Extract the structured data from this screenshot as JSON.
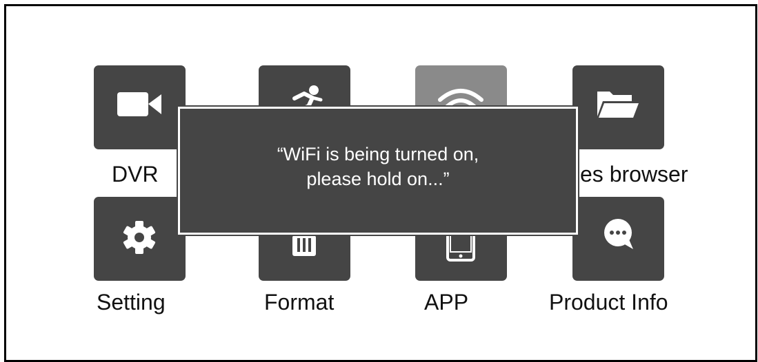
{
  "colors": {
    "tile": "#454545",
    "tile_selected": "#8a8a8a",
    "dialog": "#454545",
    "dialog_text": "#ffffff",
    "label": "#111111"
  },
  "menu": {
    "items": [
      {
        "label": "DVR",
        "icon": "video-camera-icon"
      },
      {
        "label": "",
        "icon": "running-person-icon"
      },
      {
        "label": "",
        "icon": "wifi-icon",
        "selected": true
      },
      {
        "label": "es browser",
        "icon": "folder-icon"
      },
      {
        "label": "Setting",
        "icon": "gear-icon"
      },
      {
        "label": "Format",
        "icon": "memory-card-icon"
      },
      {
        "label": "APP",
        "icon": "phone-icon"
      },
      {
        "label": "Product Info",
        "icon": "chat-bubble-icon"
      }
    ]
  },
  "dialog": {
    "line1": "“WiFi is being turned on,",
    "line2": "please hold on...”"
  }
}
